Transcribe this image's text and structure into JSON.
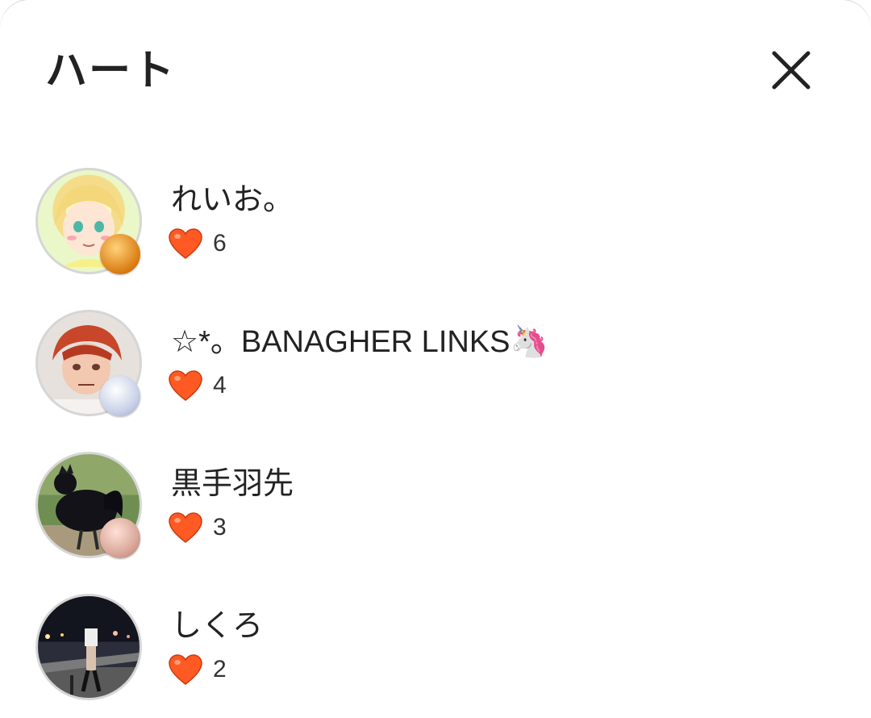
{
  "header": {
    "title": "ハート"
  },
  "close_icon": "close-icon",
  "accent": {
    "heart": "#ff5a24"
  },
  "users": [
    {
      "name": "れいお。",
      "hearts": "6",
      "avatar_bg": "#eaf7c8",
      "badge": "#e08a1e"
    },
    {
      "name": "☆*。BANAGHER LINKS🦄",
      "hearts": "4",
      "avatar_bg": "#cfc7c0",
      "badge": "#c9d2e8"
    },
    {
      "name": "黒手羽先",
      "hearts": "3",
      "avatar_bg": "#6f8f52",
      "badge": "#d9a89a"
    },
    {
      "name": "しくろ",
      "hearts": "2",
      "avatar_bg": "#1d2030",
      "badge": ""
    }
  ]
}
